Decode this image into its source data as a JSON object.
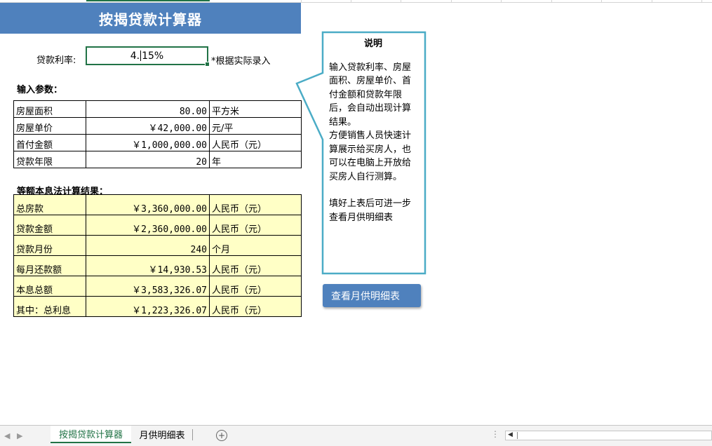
{
  "title": "按揭贷款计算器",
  "rate": {
    "label": "贷款利率:",
    "value_before_caret": "4.",
    "value_after_caret": "15%",
    "note": "*根据实际录入"
  },
  "inputs": {
    "heading": "输入参数：",
    "rows": [
      {
        "label": "房屋面积",
        "value": "80.00",
        "unit": "平方米"
      },
      {
        "label": "房屋单价",
        "value": "￥42,000.00",
        "unit": "元/平"
      },
      {
        "label": "首付金额",
        "value": "￥1,000,000.00",
        "unit": "人民币（元）"
      },
      {
        "label": "贷款年限",
        "value": "20",
        "unit": "年"
      }
    ]
  },
  "results": {
    "heading": "等额本息法计算结果：",
    "rows": [
      {
        "label": "总房款",
        "value": "￥3,360,000.00",
        "unit": "人民币（元）"
      },
      {
        "label": "贷款金额",
        "value": "￥2,360,000.00",
        "unit": "人民币（元）"
      },
      {
        "label": "贷款月份",
        "value": "240",
        "unit": "个月"
      },
      {
        "label": "每月还款额",
        "value": "￥14,930.53",
        "unit": "人民币（元）"
      },
      {
        "label": "本息总额",
        "value": "￥3,583,326.07",
        "unit": "人民币（元）"
      },
      {
        "label": "其中：总利息",
        "value": "￥1,223,326.07",
        "unit": "人民币（元）"
      }
    ]
  },
  "callout": {
    "title": "说明",
    "paragraphs": [
      "输入贷款利率、房屋面积、房屋单价、首付金额和贷款年限后，会自动出现计算结果。",
      "方便销售人员快速计算展示给买房人，也可以在电脑上开放给买房人自行测算。"
    ],
    "footer": "填好上表后可进一步查看月供明细表"
  },
  "monthly_button": "查看月供明细表",
  "sheet_tabs": [
    {
      "label": "按揭贷款计算器",
      "active": true
    },
    {
      "label": "月供明细表",
      "active": false
    }
  ],
  "add_sheet_glyph": "+",
  "colors": {
    "header_blue": "#4f81bd",
    "excel_green": "#217346",
    "result_fill": "#ffffc6",
    "callout_border": "#4bacc6"
  }
}
